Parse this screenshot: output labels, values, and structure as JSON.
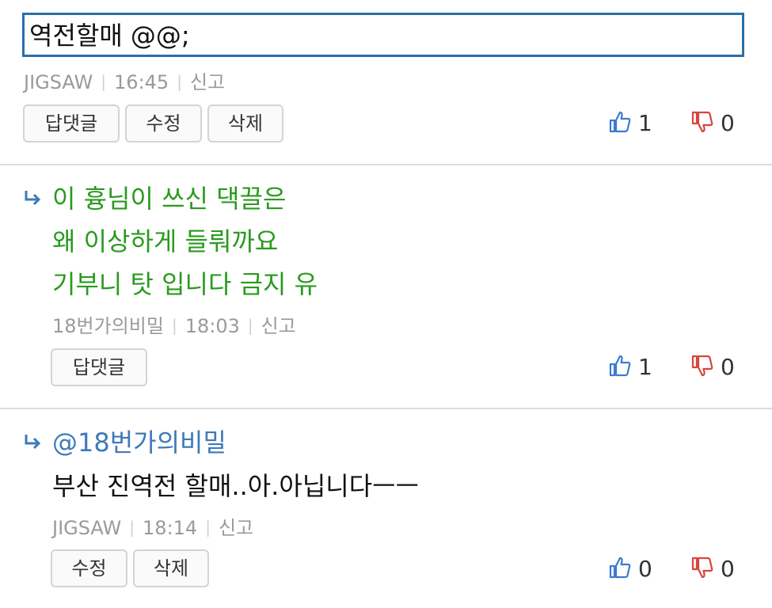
{
  "comment1": {
    "edit_value": "역전할매 @@;",
    "author": "JIGSAW",
    "time": "16:45",
    "report": "신고",
    "buttons": [
      "답댓글",
      "수정",
      "삭제"
    ],
    "likes": "1",
    "dislikes": "0"
  },
  "comment2": {
    "lines": [
      "이 흉님이 쓰신 댁끌은",
      "왜 이상하게 들뤄까요",
      "기부니 탓 입니다 금지 유"
    ],
    "author": "18번가의비밀",
    "time": "18:03",
    "report": "신고",
    "buttons": [
      "답댓글"
    ],
    "likes": "1",
    "dislikes": "0"
  },
  "comment3": {
    "mention": "@18번가의비밀",
    "text": "부산 진역전 할매..아.아닙니다ㅡㅡ",
    "author": "JIGSAW",
    "time": "18:14",
    "report": "신고",
    "buttons": [
      "수정",
      "삭제"
    ],
    "likes": "0",
    "dislikes": "0"
  },
  "colors": {
    "accent_blue": "#2a6fa8",
    "reply_green": "#2a9a1e",
    "mention_blue": "#3f7ab8",
    "like_blue": "#3c7bd0",
    "dislike_red": "#d9453a"
  },
  "icons": {
    "like": "thumbs-up-icon",
    "dislike": "thumbs-down-icon",
    "reply": "reply-arrow-icon"
  }
}
